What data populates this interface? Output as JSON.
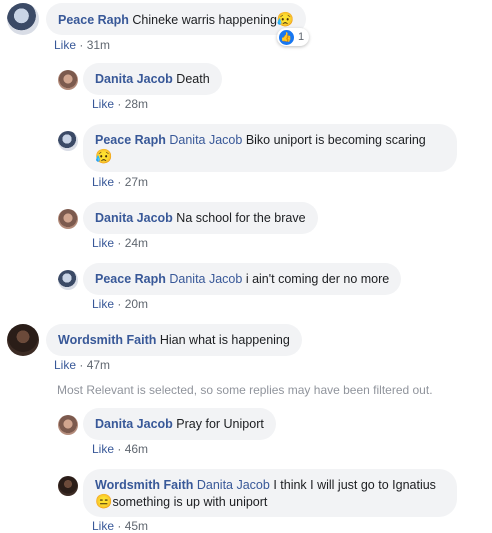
{
  "comments": [
    {
      "name": "Peace Raph",
      "text": "Chineke warris happening",
      "emoji": "😥",
      "like": "Like",
      "time": "31m",
      "reaction_count": "1"
    },
    {
      "name": "Danita Jacob",
      "text": "Death",
      "like": "Like",
      "time": "28m"
    },
    {
      "name": "Peace Raph",
      "tag": "Danita Jacob",
      "text": "Biko uniport is becoming scaring",
      "emoji": "😥",
      "like": "Like",
      "time": "27m"
    },
    {
      "name": "Danita Jacob",
      "text": "Na school for the brave",
      "like": "Like",
      "time": "24m"
    },
    {
      "name": "Peace Raph",
      "tag": "Danita Jacob",
      "text": "i ain't coming der no more",
      "like": "Like",
      "time": "20m"
    },
    {
      "name": "Wordsmith Faith",
      "text": "Hian what is happening",
      "like": "Like",
      "time": "47m"
    },
    {
      "name": "Danita Jacob",
      "text": "Pray for Uniport",
      "like": "Like",
      "time": "46m"
    },
    {
      "name": "Wordsmith Faith",
      "tag": "Danita Jacob",
      "text1": "I think I will just go to",
      "text2": "Ignatius",
      "emoji": "😑",
      "text3": "something is up with uniport",
      "like": "Like",
      "time": "45m"
    }
  ],
  "filter_note": "Most Relevant is selected, so some replies may have been filtered out.",
  "meta_separator": " · "
}
